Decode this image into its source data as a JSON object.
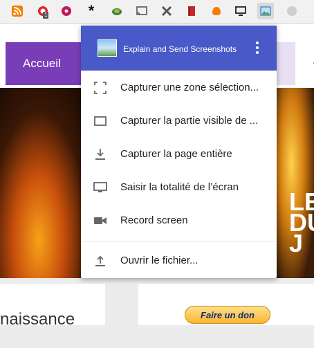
{
  "toolbar": {
    "icons": [
      {
        "name": "rss-icon",
        "color": "#f57c00"
      },
      {
        "name": "opera-icon",
        "color": "#e0262b",
        "badge": "1"
      },
      {
        "name": "donut-icon",
        "color": "#c2185b"
      },
      {
        "name": "asterisk-icon",
        "color": "#111111"
      },
      {
        "name": "turtle-icon",
        "color": "#4a7d38"
      },
      {
        "name": "cast-icon",
        "color": "#555555"
      },
      {
        "name": "tools-icon",
        "color": "#555555"
      },
      {
        "name": "book-icon",
        "color": "#c62828"
      },
      {
        "name": "paw-icon",
        "color": "#f57c00"
      },
      {
        "name": "monitor-icon",
        "color": "#222222"
      },
      {
        "name": "screenshot-icon",
        "color": "#1565c0"
      },
      {
        "name": "grey-circle-icon",
        "color": "#cfcfcf"
      }
    ]
  },
  "page": {
    "nav": {
      "home": "Accueil",
      "right_fragment": "A"
    },
    "hero_text": "LE\nDU\nJ",
    "lower_text": "naissance",
    "donate_label": "Faire un don"
  },
  "popup": {
    "title": "Explain and Send Screenshots",
    "header_color": "#4a59c8",
    "items": [
      {
        "icon": "selection-icon",
        "label": "Capturer une zone sélection..."
      },
      {
        "icon": "rectangle-icon",
        "label": "Capturer la partie visible de ..."
      },
      {
        "icon": "download-icon",
        "label": "Capturer la page entière"
      },
      {
        "icon": "desktop-icon",
        "label": "Saisir la totalité de l’écran"
      },
      {
        "icon": "video-camera-icon",
        "label": "Record screen"
      },
      {
        "icon": "upload-icon",
        "label": "Ouvrir le fichier..."
      }
    ]
  }
}
